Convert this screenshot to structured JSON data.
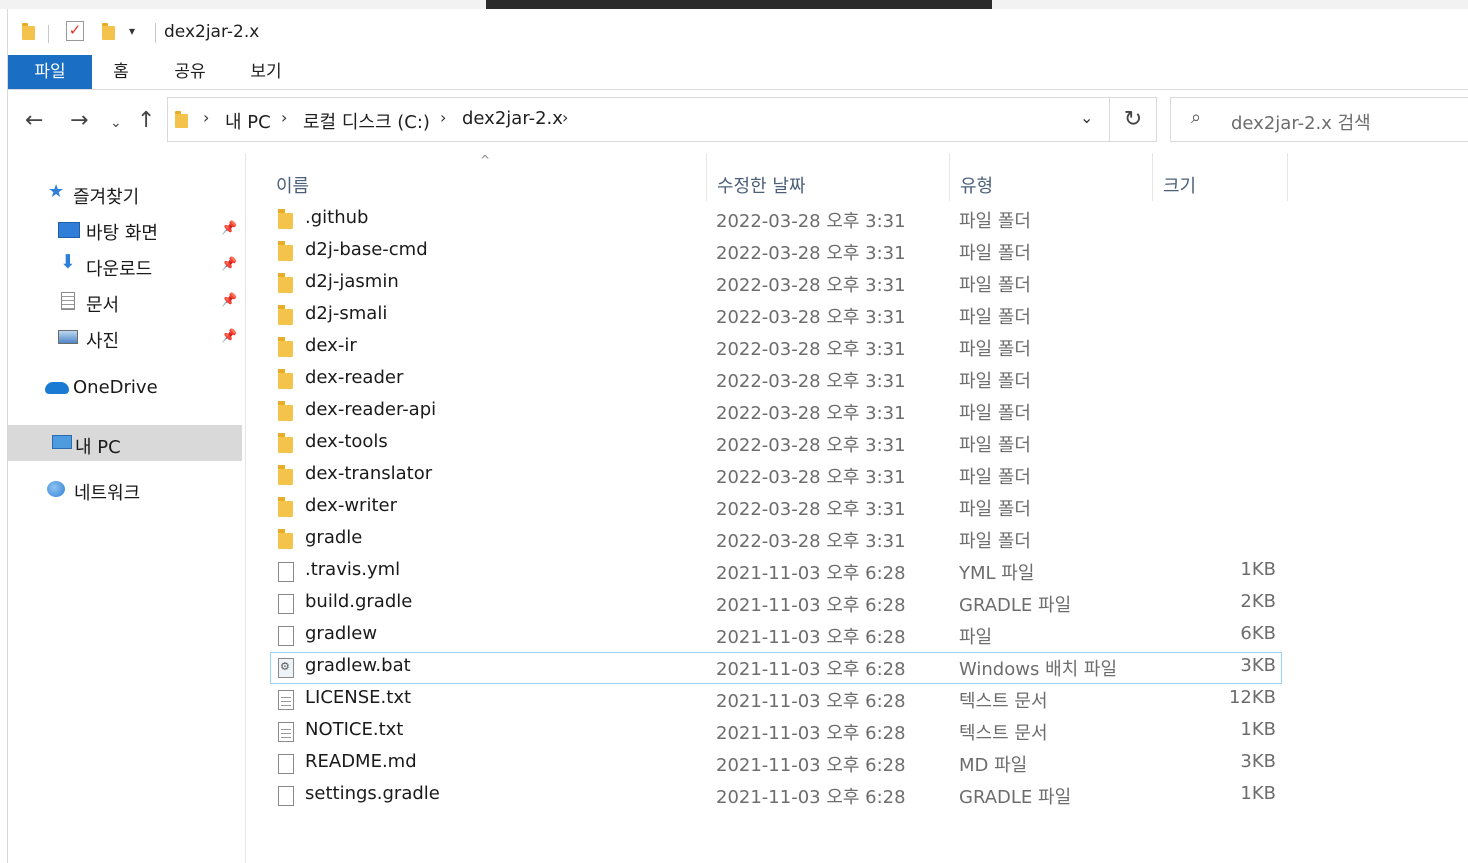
{
  "window": {
    "title": "dex2jar-2.x"
  },
  "ribbon": {
    "tabs": [
      {
        "label": "파일"
      },
      {
        "label": "홈"
      },
      {
        "label": "공유"
      },
      {
        "label": "보기"
      }
    ]
  },
  "address": {
    "crumbs": [
      "내 PC",
      "로컬 디스크 (C:)",
      "dex2jar-2.x"
    ]
  },
  "search": {
    "placeholder": "dex2jar-2.x 검색"
  },
  "nav": {
    "quick_access": "즐겨찾기",
    "pinned": [
      {
        "label": "바탕 화면",
        "icon": "desktop-icon"
      },
      {
        "label": "다운로드",
        "icon": "download-icon"
      },
      {
        "label": "문서",
        "icon": "documents-icon"
      },
      {
        "label": "사진",
        "icon": "pictures-icon"
      }
    ],
    "onedrive": "OneDrive",
    "this_pc": "내 PC",
    "network": "네트워크"
  },
  "columns": {
    "name": "이름",
    "date": "수정한 날짜",
    "type": "유형",
    "size": "크기"
  },
  "files": [
    {
      "name": ".github",
      "date": "2022-03-28 오후 3:31",
      "type": "파일 폴더",
      "size": "",
      "kind": "folder"
    },
    {
      "name": "d2j-base-cmd",
      "date": "2022-03-28 오후 3:31",
      "type": "파일 폴더",
      "size": "",
      "kind": "folder"
    },
    {
      "name": "d2j-jasmin",
      "date": "2022-03-28 오후 3:31",
      "type": "파일 폴더",
      "size": "",
      "kind": "folder"
    },
    {
      "name": "d2j-smali",
      "date": "2022-03-28 오후 3:31",
      "type": "파일 폴더",
      "size": "",
      "kind": "folder"
    },
    {
      "name": "dex-ir",
      "date": "2022-03-28 오후 3:31",
      "type": "파일 폴더",
      "size": "",
      "kind": "folder"
    },
    {
      "name": "dex-reader",
      "date": "2022-03-28 오후 3:31",
      "type": "파일 폴더",
      "size": "",
      "kind": "folder"
    },
    {
      "name": "dex-reader-api",
      "date": "2022-03-28 오후 3:31",
      "type": "파일 폴더",
      "size": "",
      "kind": "folder"
    },
    {
      "name": "dex-tools",
      "date": "2022-03-28 오후 3:31",
      "type": "파일 폴더",
      "size": "",
      "kind": "folder"
    },
    {
      "name": "dex-translator",
      "date": "2022-03-28 오후 3:31",
      "type": "파일 폴더",
      "size": "",
      "kind": "folder"
    },
    {
      "name": "dex-writer",
      "date": "2022-03-28 오후 3:31",
      "type": "파일 폴더",
      "size": "",
      "kind": "folder"
    },
    {
      "name": "gradle",
      "date": "2022-03-28 오후 3:31",
      "type": "파일 폴더",
      "size": "",
      "kind": "folder"
    },
    {
      "name": ".travis.yml",
      "date": "2021-11-03 오후 6:28",
      "type": "YML 파일",
      "size": "1KB",
      "kind": "file"
    },
    {
      "name": "build.gradle",
      "date": "2021-11-03 오후 6:28",
      "type": "GRADLE 파일",
      "size": "2KB",
      "kind": "file"
    },
    {
      "name": "gradlew",
      "date": "2021-11-03 오후 6:28",
      "type": "파일",
      "size": "6KB",
      "kind": "file"
    },
    {
      "name": "gradlew.bat",
      "date": "2021-11-03 오후 6:28",
      "type": "Windows 배치 파일",
      "size": "3KB",
      "kind": "bat"
    },
    {
      "name": "LICENSE.txt",
      "date": "2021-11-03 오후 6:28",
      "type": "텍스트 문서",
      "size": "12KB",
      "kind": "text"
    },
    {
      "name": "NOTICE.txt",
      "date": "2021-11-03 오후 6:28",
      "type": "텍스트 문서",
      "size": "1KB",
      "kind": "text"
    },
    {
      "name": "README.md",
      "date": "2021-11-03 오후 6:28",
      "type": "MD 파일",
      "size": "3KB",
      "kind": "file"
    },
    {
      "name": "settings.gradle",
      "date": "2021-11-03 오후 6:28",
      "type": "GRADLE 파일",
      "size": "1KB",
      "kind": "file"
    }
  ],
  "colors": {
    "accent": "#1a6fc4",
    "selected_nav": "#d9d9d9",
    "folder": "#f3c34b"
  }
}
